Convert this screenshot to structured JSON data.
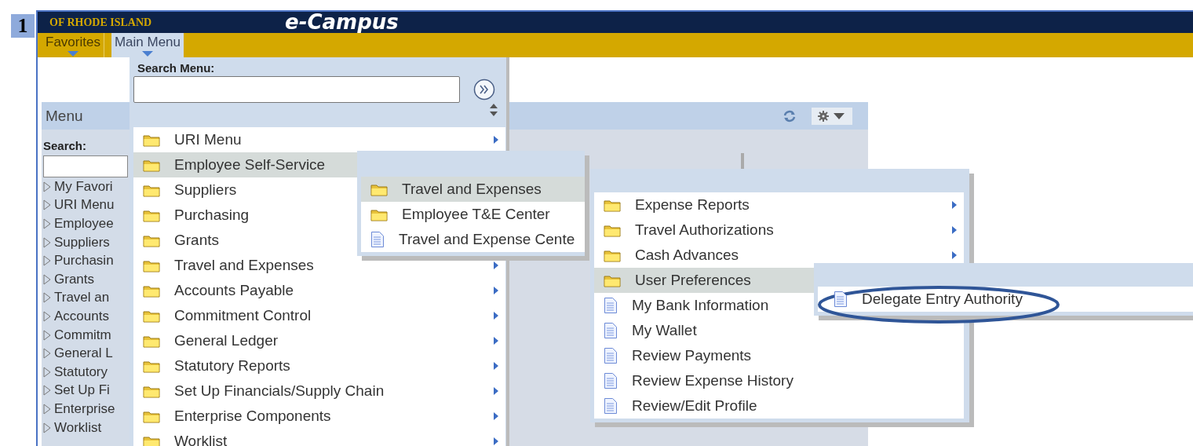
{
  "step": "1",
  "header": {
    "org": "OF RHODE ISLAND",
    "app": "e-Campus"
  },
  "nav": [
    {
      "label": "Favorites",
      "selected": false
    },
    {
      "label": "Main Menu",
      "selected": true
    }
  ],
  "panel": {
    "title": "Menu",
    "search_label": "Search:",
    "tree": [
      "My Favori",
      "URI Menu",
      "Employee",
      "Suppliers",
      "Purchasin",
      "Grants",
      "Travel an",
      "Accounts",
      "Commitm",
      "General L",
      "Statutory",
      "Set Up Fi",
      "Enterprise",
      "Worklist"
    ]
  },
  "main_menu": {
    "search_label": "Search Menu:",
    "items": [
      {
        "label": "URI Menu",
        "kind": "folder",
        "selected": false,
        "arrow": true
      },
      {
        "label": "Employee Self-Service",
        "kind": "folder",
        "selected": true
      },
      {
        "label": "Suppliers",
        "kind": "folder",
        "selected": false
      },
      {
        "label": "Purchasing",
        "kind": "folder",
        "selected": false
      },
      {
        "label": "Grants",
        "kind": "folder",
        "selected": false
      },
      {
        "label": "Travel and Expenses",
        "kind": "folder",
        "selected": false,
        "arrow": true
      },
      {
        "label": "Accounts Payable",
        "kind": "folder",
        "selected": false,
        "arrow": true
      },
      {
        "label": "Commitment Control",
        "kind": "folder",
        "selected": false,
        "arrow": true
      },
      {
        "label": "General Ledger",
        "kind": "folder",
        "selected": false,
        "arrow": true
      },
      {
        "label": "Statutory Reports",
        "kind": "folder",
        "selected": false,
        "arrow": true
      },
      {
        "label": "Set Up Financials/Supply Chain",
        "kind": "folder",
        "selected": false,
        "arrow": true
      },
      {
        "label": "Enterprise Components",
        "kind": "folder",
        "selected": false,
        "arrow": true
      },
      {
        "label": "Worklist",
        "kind": "folder",
        "selected": false,
        "arrow": true
      }
    ]
  },
  "submenus": [
    {
      "items": [
        {
          "label": "Travel and Expenses",
          "kind": "folder",
          "selected": true,
          "circled": false
        },
        {
          "label": "Employee T&E Center",
          "kind": "folder",
          "selected": false,
          "circled": false
        },
        {
          "label": "Travel and Expense Cente",
          "kind": "page",
          "selected": false,
          "circled": false
        }
      ]
    },
    {
      "items": [
        {
          "label": "Expense Reports",
          "kind": "folder",
          "selected": false,
          "arrow": true,
          "circled": false
        },
        {
          "label": "Travel Authorizations",
          "kind": "folder",
          "selected": false,
          "arrow": true,
          "circled": false
        },
        {
          "label": "Cash Advances",
          "kind": "folder",
          "selected": false,
          "arrow": true,
          "circled": false
        },
        {
          "label": "User Preferences",
          "kind": "folder",
          "selected": true,
          "circled": false
        },
        {
          "label": "My Bank Information",
          "kind": "page",
          "selected": false,
          "circled": false
        },
        {
          "label": "My Wallet",
          "kind": "page",
          "selected": false,
          "circled": false
        },
        {
          "label": "Review Payments",
          "kind": "page",
          "selected": false,
          "circled": false
        },
        {
          "label": "Review Expense History",
          "kind": "page",
          "selected": false,
          "circled": false
        },
        {
          "label": "Review/Edit Profile",
          "kind": "page",
          "selected": false,
          "circled": false
        }
      ]
    },
    {
      "items": [
        {
          "label": "Delegate Entry Authority",
          "kind": "page",
          "selected": false,
          "circled": true
        }
      ]
    }
  ]
}
